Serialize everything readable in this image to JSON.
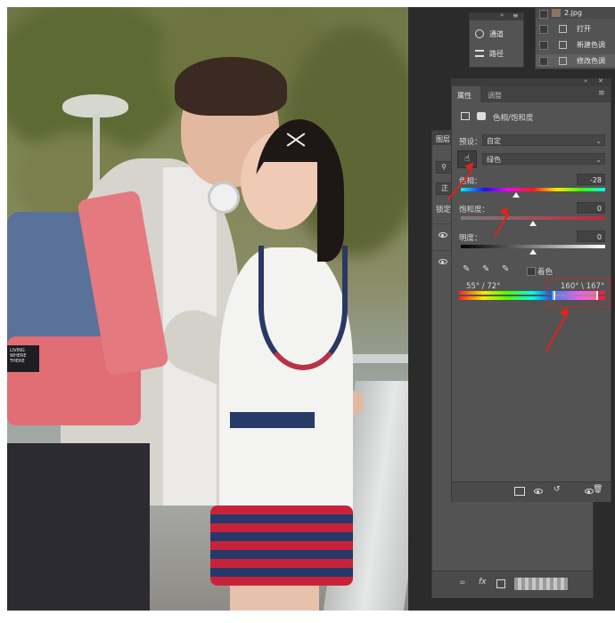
{
  "channels_panel": {
    "items": [
      {
        "icon": "channels-icon",
        "label": "通道"
      },
      {
        "icon": "paths-icon",
        "label": "路径"
      }
    ]
  },
  "history_panel": {
    "doc_name": "2.jpg",
    "items": [
      "打开",
      "新建色调",
      "修改色调"
    ]
  },
  "layers_panel": {
    "tab": "图层",
    "blend_label": "正",
    "lock_label": "锁定"
  },
  "properties_panel": {
    "tabs": [
      "属性",
      "调整"
    ],
    "title": "色相/饱和度",
    "preset_label": "预设：",
    "preset_value": "自定",
    "channel_value": "绿色",
    "hue_label": "色相：",
    "hue_value": "-28",
    "saturation_label": "饱和度：",
    "saturation_value": "0",
    "lightness_label": "明度：",
    "lightness_value": "0",
    "colorize_label": "着色",
    "range_left": "55° / 72°",
    "range_right": "160° \\ 167°",
    "hue_slider_fraction": 0.38,
    "saturation_slider_fraction": 0.5,
    "lightness_slider_fraction": 0.5
  },
  "photo": {
    "bag_patch_text": "LIVING\nWHERE\nTHERE"
  },
  "colors": {
    "ui_dark": "#2b2b2b",
    "panel": "#535353",
    "annotation_red": "#e2231a"
  }
}
